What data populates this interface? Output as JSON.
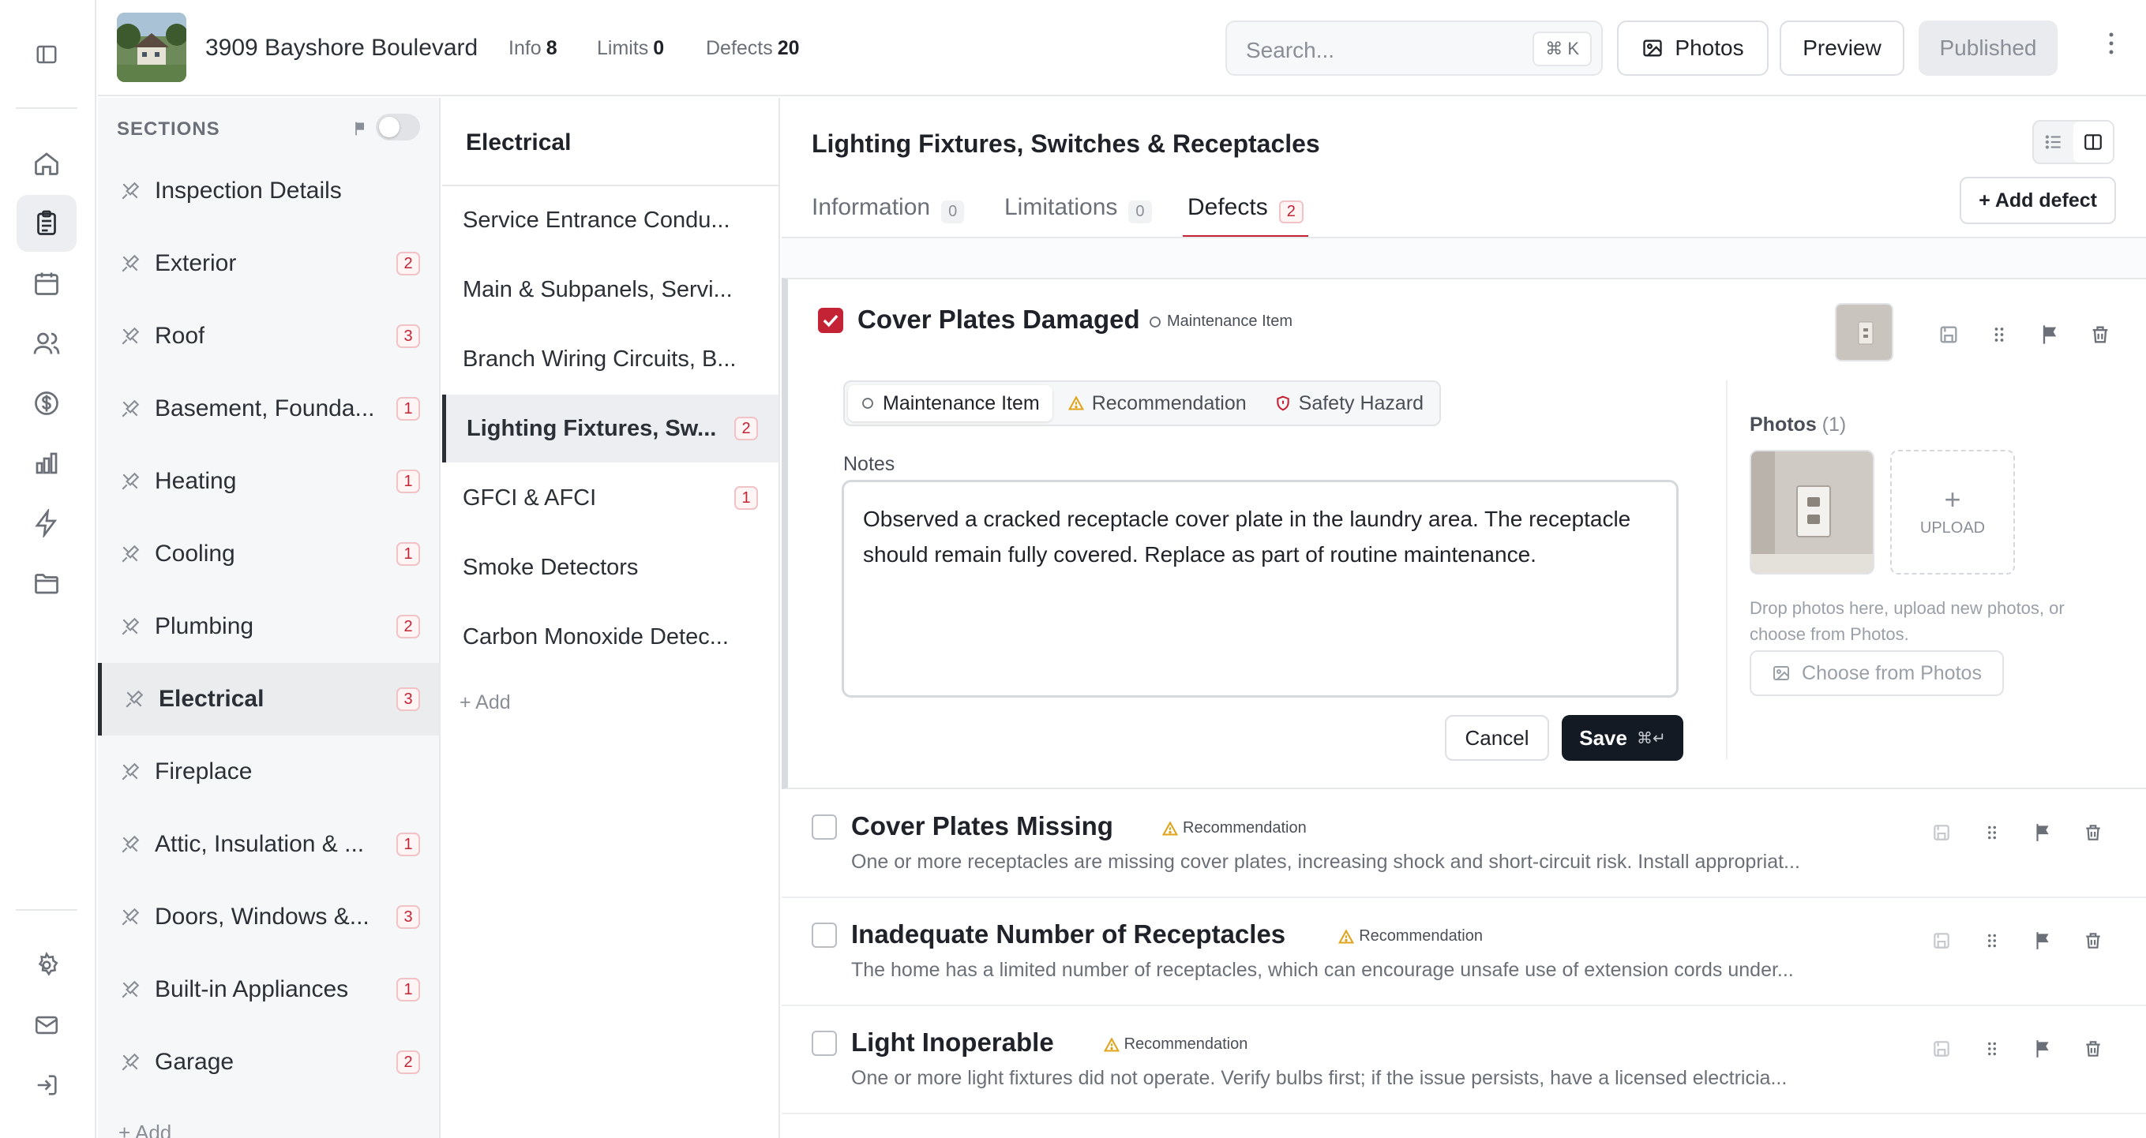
{
  "header": {
    "address": "3909 Bayshore Boulevard",
    "stats": [
      {
        "label": "Info",
        "value": "8"
      },
      {
        "label": "Limits",
        "value": "0"
      },
      {
        "label": "Defects",
        "value": "20"
      }
    ],
    "search_placeholder": "Search...",
    "search_shortcut": "⌘ K",
    "photos_label": "Photos",
    "preview_label": "Preview",
    "published_label": "Published"
  },
  "rail": {
    "icons": [
      "sidebar-toggle-icon",
      "home-icon",
      "clipboard-icon",
      "calendar-icon",
      "users-icon",
      "dollar-icon",
      "bar-chart-icon",
      "bolt-icon",
      "folder-icon",
      "settings-icon",
      "mail-icon",
      "logout-icon"
    ]
  },
  "sections": {
    "heading": "SECTIONS",
    "items": [
      {
        "label": "Inspection Details",
        "count": ""
      },
      {
        "label": "Exterior",
        "count": "2"
      },
      {
        "label": "Roof",
        "count": "3"
      },
      {
        "label": "Basement, Founda...",
        "count": "1"
      },
      {
        "label": "Heating",
        "count": "1"
      },
      {
        "label": "Cooling",
        "count": "1"
      },
      {
        "label": "Plumbing",
        "count": "2"
      },
      {
        "label": "Electrical",
        "count": "3"
      },
      {
        "label": "Fireplace",
        "count": ""
      },
      {
        "label": "Attic, Insulation & ...",
        "count": "1"
      },
      {
        "label": "Doors, Windows &...",
        "count": "3"
      },
      {
        "label": "Built-in Appliances",
        "count": "1"
      },
      {
        "label": "Garage",
        "count": "2"
      }
    ],
    "add_label": "+ Add"
  },
  "subsections": {
    "title": "Electrical",
    "items": [
      {
        "label": "Service Entrance Condu...",
        "count": ""
      },
      {
        "label": "Main & Subpanels, Servi...",
        "count": ""
      },
      {
        "label": "Branch Wiring Circuits, B...",
        "count": ""
      },
      {
        "label": "Lighting Fixtures, Sw...",
        "count": "2"
      },
      {
        "label": "GFCI & AFCI",
        "count": "1"
      },
      {
        "label": "Smoke Detectors",
        "count": ""
      },
      {
        "label": "Carbon Monoxide Detec...",
        "count": ""
      }
    ],
    "add_label": "+ Add"
  },
  "main": {
    "title": "Lighting Fixtures, Switches & Receptacles",
    "tabs": [
      {
        "label": "Information",
        "count": "0"
      },
      {
        "label": "Limitations",
        "count": "0"
      },
      {
        "label": "Defects",
        "count": "2"
      }
    ],
    "add_defect": "+ Add defect",
    "expanded": {
      "title": "Cover Plates Damaged",
      "tag": "Maintenance Item",
      "severity_options": [
        "Maintenance Item",
        "Recommendation",
        "Safety Hazard"
      ],
      "notes_label": "Notes",
      "notes": "Observed a cracked receptacle cover plate in the laundry area. The receptacle should remain fully covered. Replace as part of routine maintenance.",
      "cancel": "Cancel",
      "save": "Save",
      "save_shortcut": "⌘↵",
      "photos_label": "Photos",
      "photos_count": "(1)",
      "upload": "UPLOAD",
      "drop_hint": "Drop photos here, upload new photos, or choose from Photos.",
      "choose": "Choose from Photos"
    },
    "defects": [
      {
        "title": "Cover Plates Missing",
        "tag": "Recommendation",
        "desc": "One or more receptacles are missing cover plates, increasing shock and short-circuit risk. Install appropriat..."
      },
      {
        "title": "Inadequate Number of Receptacles",
        "tag": "Recommendation",
        "desc": "The home has a limited number of receptacles, which can encourage unsafe use of extension cords under..."
      },
      {
        "title": "Light Inoperable",
        "tag": "Recommendation",
        "desc": "One or more light fixtures did not operate. Verify bulbs first; if the issue persists, have a licensed electricia..."
      }
    ]
  },
  "colors": {
    "accent": "#c42335",
    "dark": "#141a24",
    "warning": "#e0a31a"
  }
}
